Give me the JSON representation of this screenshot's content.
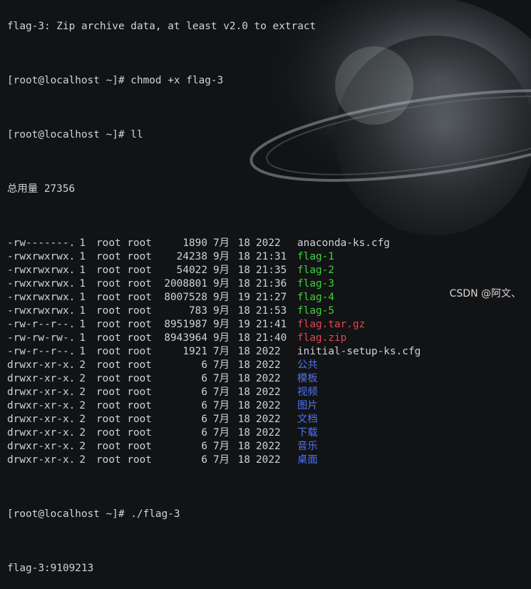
{
  "terminal": {
    "top_partial_line": "flag-3: Zip archive data, at least v2.0 to extract",
    "prompt": "[root@localhost ~]# ",
    "cmd1": "chmod +x flag-3",
    "cmd2": "ll",
    "total_line": "总用量 27356",
    "files": [
      {
        "perm": "-rw-------.",
        "links": "1",
        "owner": "root root",
        "size": "1890",
        "month": "7月",
        "day": "18",
        "time": "2022",
        "name": "anaconda-ks.cfg",
        "color": "default"
      },
      {
        "perm": "-rwxrwxrwx.",
        "links": "1",
        "owner": "root root",
        "size": "24238",
        "month": "9月",
        "day": "18",
        "time": "21:31",
        "name": "flag-1",
        "color": "green"
      },
      {
        "perm": "-rwxrwxrwx.",
        "links": "1",
        "owner": "root root",
        "size": "54022",
        "month": "9月",
        "day": "18",
        "time": "21:35",
        "name": "flag-2",
        "color": "green"
      },
      {
        "perm": "-rwxrwxrwx.",
        "links": "1",
        "owner": "root root",
        "size": "2008801",
        "month": "9月",
        "day": "18",
        "time": "21:36",
        "name": "flag-3",
        "color": "green"
      },
      {
        "perm": "-rwxrwxrwx.",
        "links": "1",
        "owner": "root root",
        "size": "8007528",
        "month": "9月",
        "day": "19",
        "time": "21:27",
        "name": "flag-4",
        "color": "green"
      },
      {
        "perm": "-rwxrwxrwx.",
        "links": "1",
        "owner": "root root",
        "size": "783",
        "month": "9月",
        "day": "18",
        "time": "21:53",
        "name": "flag-5",
        "color": "green"
      },
      {
        "perm": "-rw-r--r--.",
        "links": "1",
        "owner": "root root",
        "size": "8951987",
        "month": "9月",
        "day": "19",
        "time": "21:41",
        "name": "flag.tar.gz",
        "color": "red"
      },
      {
        "perm": "-rw-rw-rw-.",
        "links": "1",
        "owner": "root root",
        "size": "8943964",
        "month": "9月",
        "day": "18",
        "time": "21:40",
        "name": "flag.zip",
        "color": "red"
      },
      {
        "perm": "-rw-r--r--.",
        "links": "1",
        "owner": "root root",
        "size": "1921",
        "month": "7月",
        "day": "18",
        "time": "2022",
        "name": "initial-setup-ks.cfg",
        "color": "default"
      },
      {
        "perm": "drwxr-xr-x.",
        "links": "2",
        "owner": "root root",
        "size": "6",
        "month": "7月",
        "day": "18",
        "time": "2022",
        "name": "公共",
        "color": "blue"
      },
      {
        "perm": "drwxr-xr-x.",
        "links": "2",
        "owner": "root root",
        "size": "6",
        "month": "7月",
        "day": "18",
        "time": "2022",
        "name": "模板",
        "color": "blue"
      },
      {
        "perm": "drwxr-xr-x.",
        "links": "2",
        "owner": "root root",
        "size": "6",
        "month": "7月",
        "day": "18",
        "time": "2022",
        "name": "视频",
        "color": "blue"
      },
      {
        "perm": "drwxr-xr-x.",
        "links": "2",
        "owner": "root root",
        "size": "6",
        "month": "7月",
        "day": "18",
        "time": "2022",
        "name": "图片",
        "color": "blue"
      },
      {
        "perm": "drwxr-xr-x.",
        "links": "2",
        "owner": "root root",
        "size": "6",
        "month": "7月",
        "day": "18",
        "time": "2022",
        "name": "文档",
        "color": "blue"
      },
      {
        "perm": "drwxr-xr-x.",
        "links": "2",
        "owner": "root root",
        "size": "6",
        "month": "7月",
        "day": "18",
        "time": "2022",
        "name": "下载",
        "color": "blue"
      },
      {
        "perm": "drwxr-xr-x.",
        "links": "2",
        "owner": "root root",
        "size": "6",
        "month": "7月",
        "day": "18",
        "time": "2022",
        "name": "音乐",
        "color": "blue"
      },
      {
        "perm": "drwxr-xr-x.",
        "links": "2",
        "owner": "root root",
        "size": "6",
        "month": "7月",
        "day": "18",
        "time": "2022",
        "name": "桌面",
        "color": "blue"
      }
    ],
    "cmd3": "./flag-3",
    "output": "flag-3:9109213"
  },
  "watermark": "CSDN @阿文、",
  "colors": {
    "background": "#121315",
    "text": "#cfd3d8",
    "executable": "#3fd23f",
    "archive": "#e2464e",
    "directory": "#4f72f4"
  }
}
